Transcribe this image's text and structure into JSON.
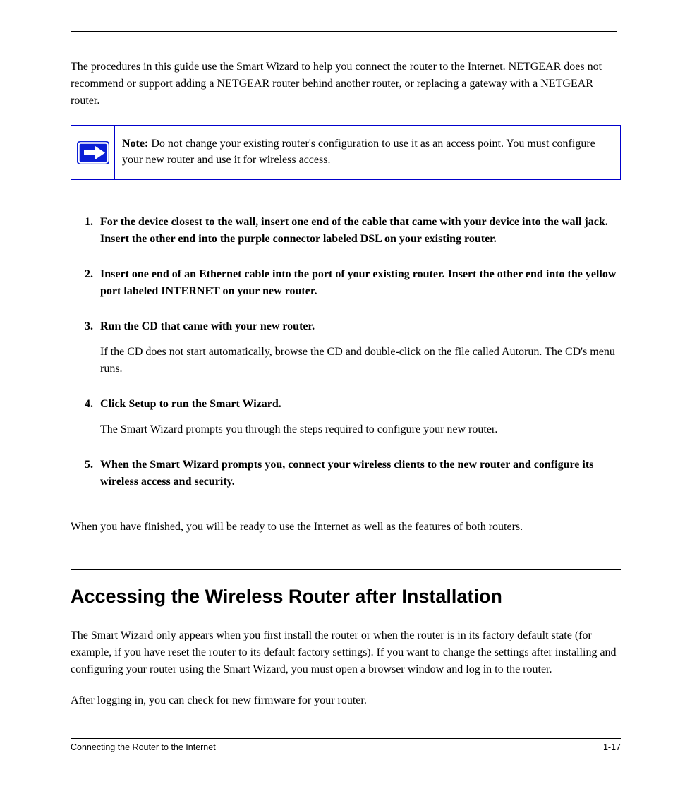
{
  "intro": "The procedures in this guide use the Smart Wizard to help you connect the router to the Internet. NETGEAR does not recommend or support adding a NETGEAR router behind another router, or replacing a gateway with a NETGEAR router.",
  "note": {
    "label": "Note:",
    "text": " Do not change your existing router's configuration to use it as an access point. You must configure your new router and use it for wireless access."
  },
  "steps": [
    {
      "main": "For the device closest to the wall, insert one end of the cable that came with your device into the wall jack. Insert the other end into the purple connector labeled DSL on your existing router.",
      "sub": ""
    },
    {
      "main": "Insert one end of an Ethernet cable into the port of your existing router. Insert the other end into the yellow port labeled INTERNET on your new router.",
      "sub": ""
    },
    {
      "main": "Run the CD that came with your new router.",
      "sub": "If the CD does not start automatically, browse the CD and double-click on the file called Autorun. The CD's menu runs."
    },
    {
      "main": "Click Setup to run the Smart Wizard.",
      "sub": "The Smart Wizard prompts you through the steps required to configure your new router."
    },
    {
      "main": "When the Smart Wizard prompts you, connect your wireless clients to the new router and configure its wireless access and security.",
      "sub": ""
    }
  ],
  "closing": "When you have finished, you will be ready to use the Internet as well as the features of both routers.",
  "section_heading": "Accessing the Wireless Router after Installation",
  "section_body_1": "The Smart Wizard only appears when you first install the router or when the router is in its factory default state (for example, if you have reset the router to its default factory settings). If you want to change the settings after installing and configuring your router using the Smart Wizard, you must open a browser window and log in to the router.",
  "section_body_2": "After logging in, you can check for new firmware for your router.",
  "footer": {
    "left": "Connecting the Router to the Internet",
    "right": "1-17"
  }
}
